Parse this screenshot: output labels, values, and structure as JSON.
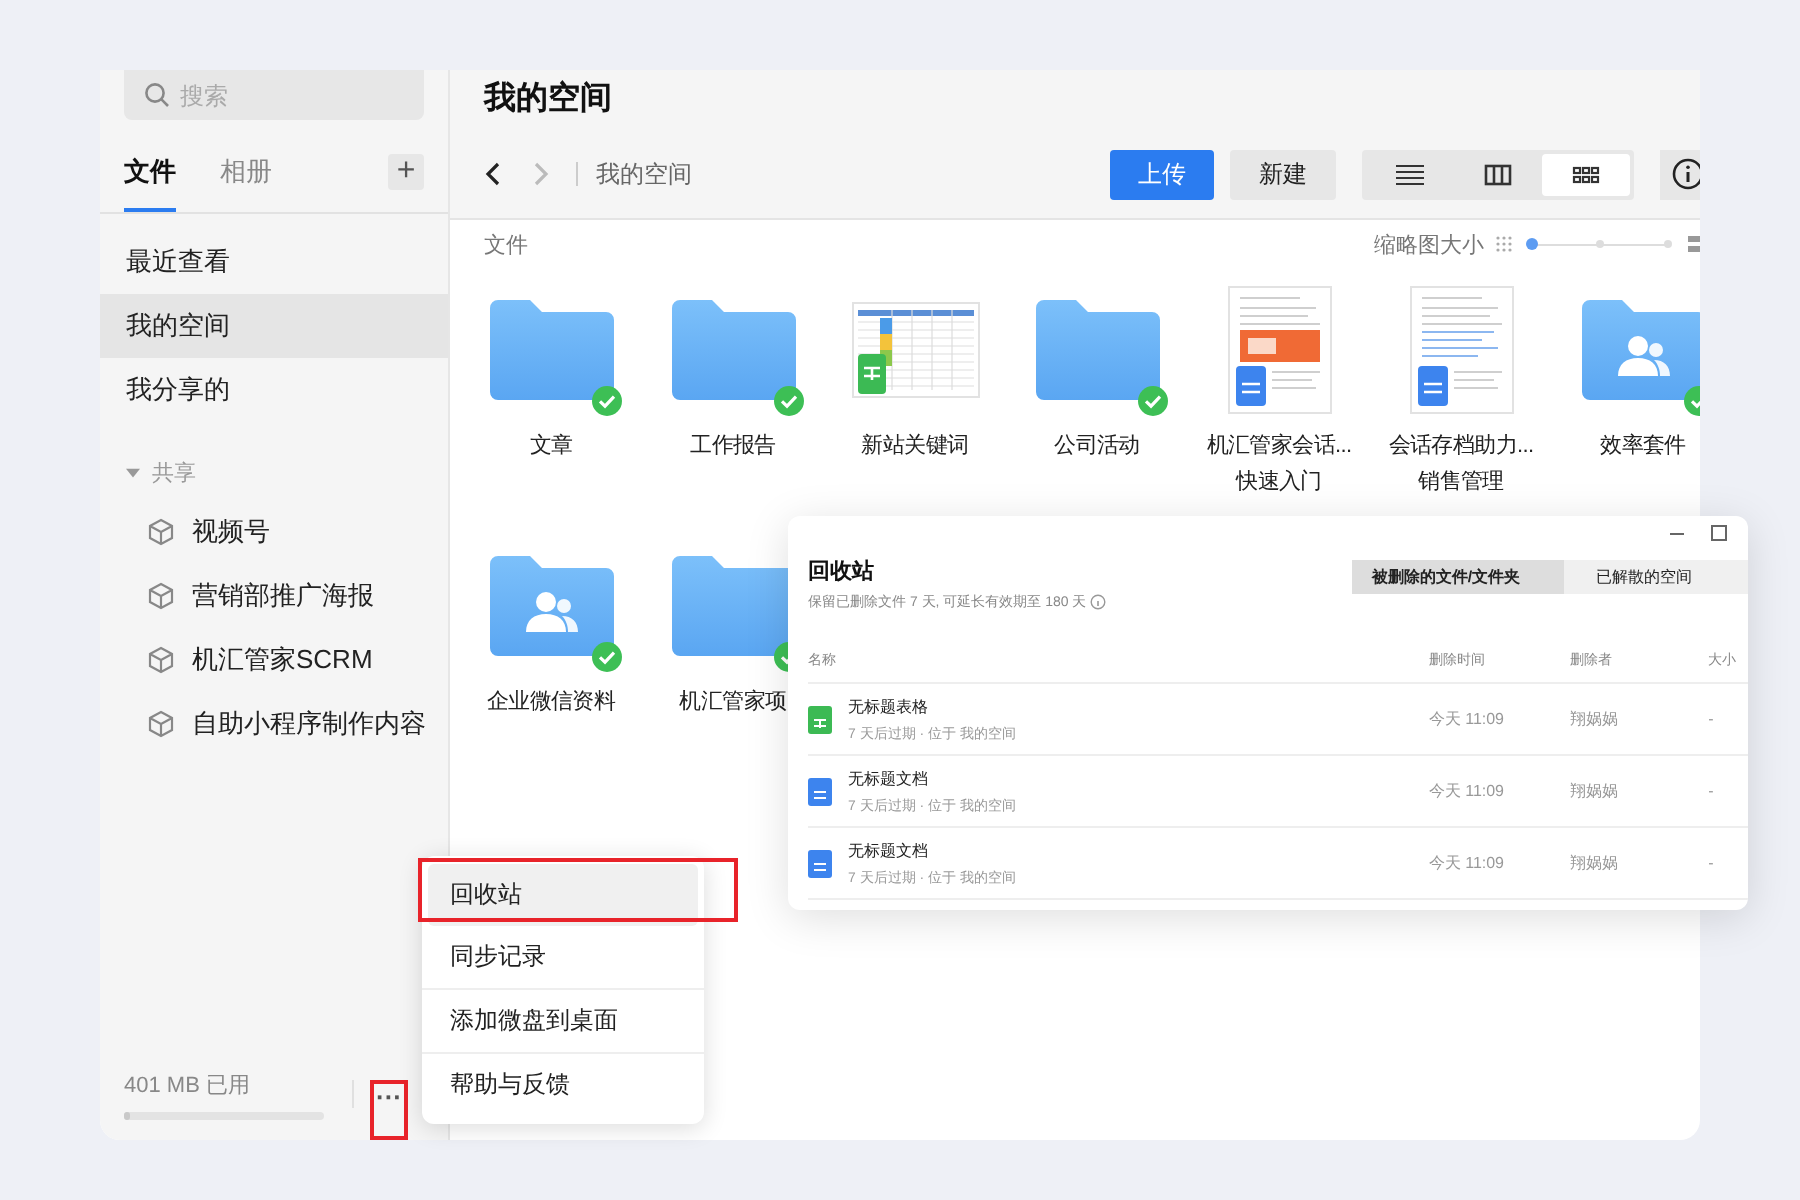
{
  "sidebar": {
    "search": {
      "placeholder": "搜索"
    },
    "tabs": [
      {
        "label": "文件",
        "selected": true
      },
      {
        "label": "相册",
        "selected": false
      }
    ],
    "add_button": "+",
    "nav": [
      {
        "label": "最近查看",
        "selected": false
      },
      {
        "label": "我的空间",
        "selected": true
      },
      {
        "label": "我分享的",
        "selected": false
      }
    ],
    "shared": {
      "label": "共享",
      "expanded": true,
      "children": [
        {
          "label": "视频号"
        },
        {
          "label": "营销部推广海报"
        },
        {
          "label": "机汇管家SCRM"
        },
        {
          "label": "自助小程序制作内容"
        }
      ]
    },
    "storage": {
      "text": "401 MB 已用",
      "level": 0.03
    },
    "more_button": "···"
  },
  "main": {
    "title": "我的空间",
    "breadcrumb": "我的空间",
    "buttons": [
      {
        "label": "上传",
        "kind": "primary"
      },
      {
        "label": "新建",
        "kind": "default"
      }
    ],
    "views": [
      {
        "kind": "list",
        "selected": false
      },
      {
        "kind": "columns",
        "selected": false
      },
      {
        "kind": "grid",
        "selected": true
      }
    ],
    "section_label": "文件",
    "thumb_size": {
      "label": "缩略图大小",
      "level": 0
    },
    "items": [
      {
        "kind": "folder",
        "lines": [
          "文章"
        ],
        "synced": true
      },
      {
        "kind": "folder",
        "lines": [
          "工作报告"
        ],
        "synced": true
      },
      {
        "kind": "sheet",
        "lines": [
          "新站关键词"
        ],
        "synced": false
      },
      {
        "kind": "folder",
        "lines": [
          "公司活动"
        ],
        "synced": true
      },
      {
        "kind": "doc",
        "lines": [
          "机汇管家会话...",
          "快速入门"
        ],
        "synced": false
      },
      {
        "kind": "doc",
        "lines": [
          "会话存档助力...",
          "销售管理"
        ],
        "synced": false
      },
      {
        "kind": "shared_folder",
        "lines": [
          "效率套件"
        ],
        "synced": true
      },
      {
        "kind": "shared_folder",
        "lines": [
          "企业微信资料"
        ],
        "synced": true
      },
      {
        "kind": "folder",
        "lines": [
          "机汇管家项"
        ],
        "synced": true
      }
    ]
  },
  "recycle_bin": {
    "title": "回收站",
    "subtitle": "保留已删除文件 7 天, 可延长有效期至 180 天",
    "tabs": [
      {
        "label": "被删除的文件/文件夹",
        "selected": true
      },
      {
        "label": "已解散的空间",
        "selected": false
      }
    ],
    "columns": [
      "名称",
      "删除时间",
      "删除者",
      "大小"
    ],
    "rows": [
      {
        "kind": "sheet",
        "name": "无标题表格",
        "detail": "7 天后过期 · 位于 我的空间",
        "time": "今天 11:09",
        "by": "翔娲娲",
        "size": "-"
      },
      {
        "kind": "doc",
        "name": "无标题文档",
        "detail": "7 天后过期 · 位于 我的空间",
        "time": "今天 11:09",
        "by": "翔娲娲",
        "size": "-"
      },
      {
        "kind": "doc",
        "name": "无标题文档",
        "detail": "7 天后过期 · 位于 我的空间",
        "time": "今天 11:09",
        "by": "翔娲娲",
        "size": "-"
      }
    ]
  },
  "menu": [
    {
      "label": "回收站",
      "selected": true
    },
    {
      "label": "同步记录",
      "selected": false
    },
    {
      "label": "添加微盘到桌面",
      "selected": false
    },
    {
      "label": "帮助与反馈",
      "selected": false
    }
  ]
}
